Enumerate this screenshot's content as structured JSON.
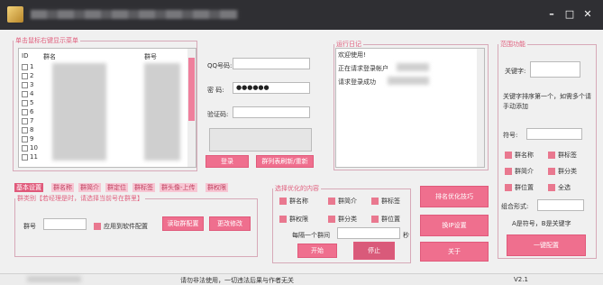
{
  "window": {
    "minimize": "–",
    "maximize": "□",
    "close": "✕"
  },
  "list_panel": {
    "legend": "单击鼠标右键显示菜单",
    "columns": [
      "ID",
      "群名",
      "群号"
    ],
    "rows": [
      "1",
      "2",
      "3",
      "4",
      "5",
      "6",
      "7",
      "8",
      "9",
      "10",
      "11"
    ]
  },
  "login": {
    "qq_label": "QQ号码:",
    "pwd_label": "密  码:",
    "pwd_value": "●●●●●●",
    "verify_label": "验证码:",
    "login_button": "登录",
    "refresh_button": "群列表刷新/重新"
  },
  "log": {
    "legend": "运行日记",
    "lines": [
      "欢迎使用!",
      "正在请求登录帐户",
      "请求登录成功"
    ]
  },
  "keyword": {
    "legend": "范围功能",
    "keyword_label": "关键字:",
    "tip": "关键字排序第一个，如需多个请手动添加",
    "symbol_label": "符号:",
    "opt_name": "群名称",
    "opt_tag": "群标签",
    "opt_intro": "群简介",
    "opt_cat": "群分类",
    "opt_loc": "群位置",
    "opt_all": "全选",
    "combo_label": "组合形式:",
    "combo_hint": "A是符号，B是关键字",
    "apply_button": "一键配置"
  },
  "tabs": [
    "基本设置",
    "群名称",
    "群简介",
    "群定位",
    "群标签",
    "群头像-上传",
    "群权限"
  ],
  "config": {
    "legend": "群类别【若经理是时，请选择当前号在群里】",
    "qun_label": "群号",
    "apply_software": "应用到软件配置",
    "read_button": "读取群配置",
    "modify_button": "更改修改"
  },
  "optimize": {
    "legend": "选择优化的内容",
    "opt1": "群名称",
    "opt2": "群简介",
    "opt3": "群标签",
    "opt4": "群权限",
    "opt5": "群分类",
    "opt6": "群位置",
    "interval_label": "每隔一个群间",
    "interval_unit": "秒",
    "start_button": "开始",
    "stop_button": "停止"
  },
  "side_buttons": {
    "rank": "排名优化技巧",
    "ip": "换IP设置",
    "about": "关于"
  },
  "status": {
    "text": "请勿非法使用，一切违法后果与作者无关",
    "version": "V2.1"
  },
  "colors": {
    "accent": "#ef6f8e",
    "titlebar": "#2f2f33"
  }
}
